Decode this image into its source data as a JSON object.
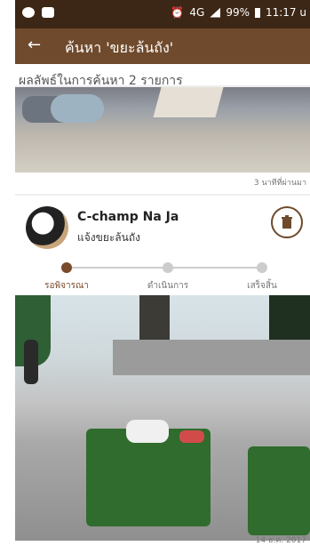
{
  "status_bar": {
    "time": "11:17 u",
    "battery": "99%",
    "network": "4G"
  },
  "app_bar": {
    "back_icon": "back-arrow-icon",
    "title": "ค้นหา 'ขยะล้นถัง'"
  },
  "results": {
    "header": "ผลลัพธ์ในการค้นหา 2 รายการ"
  },
  "cards": [
    {
      "timestamp": "3 นาทีที่ผ่านมา"
    },
    {
      "user_name": "C-champ Na Ja",
      "report_title": "แจ้งขยะล้นถัง",
      "status_steps": [
        {
          "label": "รอพิจารณา",
          "active": true
        },
        {
          "label": "ดำเนินการ",
          "active": false
        },
        {
          "label": "เสร็จสิ้น",
          "active": false
        }
      ],
      "progress": 0.0,
      "date": "14 ธ.ค. 2017",
      "delete_icon": "trash-icon"
    }
  ],
  "colors": {
    "primary": "#6f4a2c",
    "accent": "#7a4a2b",
    "statusbar": "#3c2615"
  }
}
